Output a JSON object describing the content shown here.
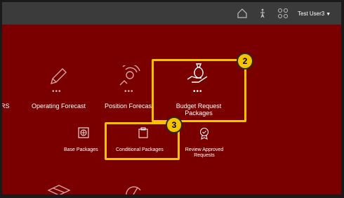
{
  "header": {
    "user_name": "Test User3",
    "icons": [
      "home-icon",
      "accessibility-icon",
      "navigator-grid-icon"
    ]
  },
  "cards": {
    "partial_left": {
      "label": "RS"
    },
    "operating_forecast": {
      "label": "Operating Forecast",
      "icon": "pencil-icon"
    },
    "position_forecast": {
      "label": "Position Forecast",
      "icon": "position-rings-icon"
    },
    "budget_request_packages": {
      "label_line1": "Budget Request",
      "label_line2": "Packages",
      "icon": "hand-money-bag-icon"
    },
    "base_packages": {
      "label": "Base Packages",
      "icon": "base-package-icon"
    },
    "conditional_packages": {
      "label": "Conditional Packages",
      "icon": "clipboard-icon"
    },
    "review_approved_requests": {
      "label_line1": "Review Approved",
      "label_line2": "Requests",
      "icon": "approved-badge-icon"
    }
  },
  "callouts": {
    "step2": {
      "number": "2"
    },
    "step3": {
      "number": "3"
    }
  },
  "colors": {
    "topbar": "#3b3b3b",
    "background": "#7a0000",
    "highlight": "#f7c200"
  }
}
